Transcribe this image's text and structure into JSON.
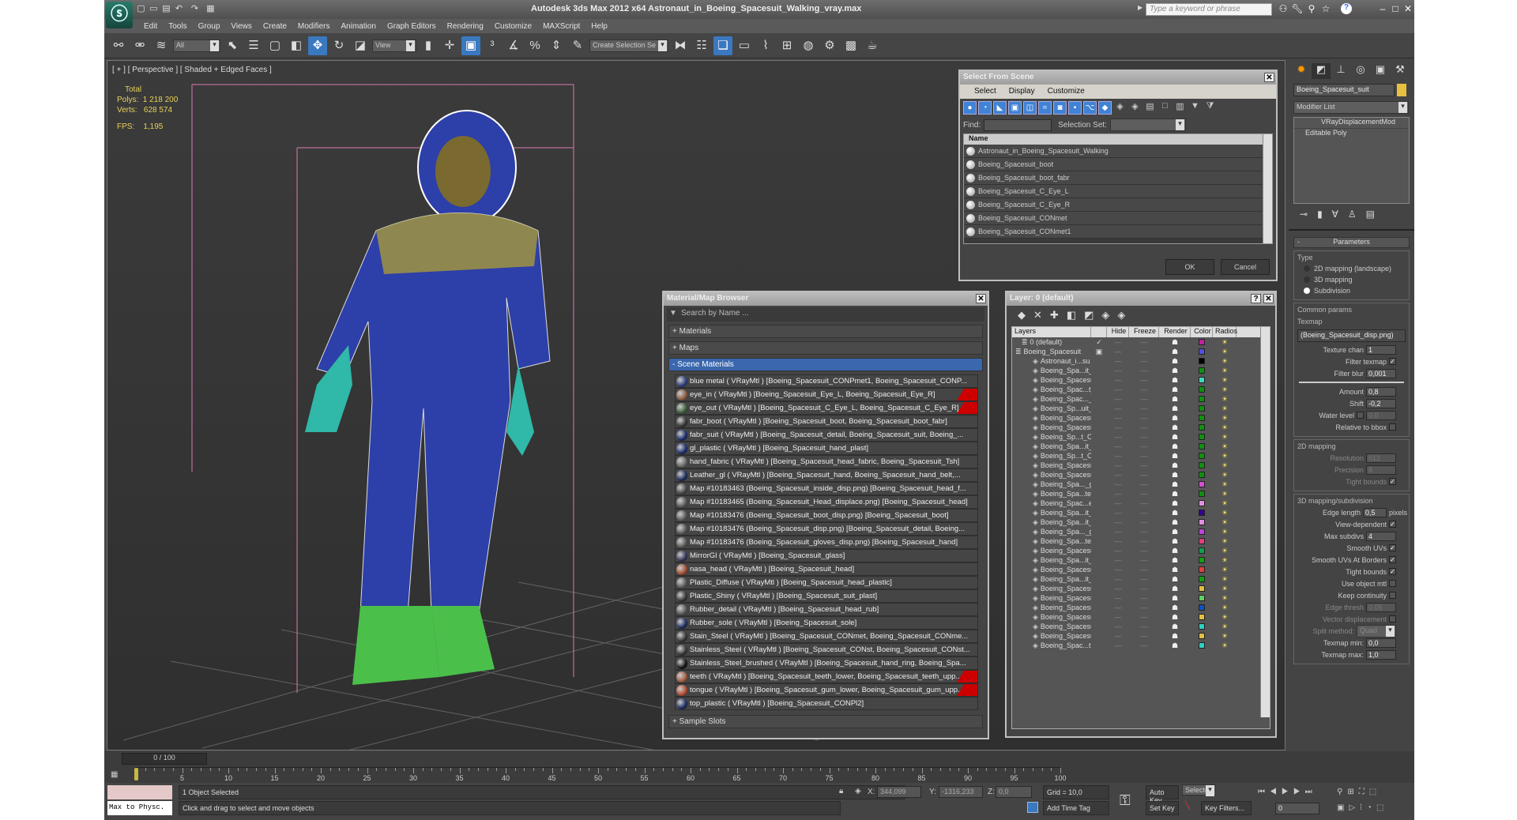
{
  "app": {
    "title": "Autodesk 3ds Max  2012 x64    Astronaut_in_Boeing_Spacesuit_Walking_vray.max",
    "search_placeholder": "Type a keyword or phrase"
  },
  "menu": [
    "Edit",
    "Tools",
    "Group",
    "Views",
    "Create",
    "Modifiers",
    "Animation",
    "Graph Editors",
    "Rendering",
    "Customize",
    "MAXScript",
    "Help"
  ],
  "toolbar": {
    "filter_value": "All",
    "ref_coord_value": "View",
    "selection_set_placeholder": "Create Selection Se"
  },
  "viewport": {
    "label": "[ + ] [ Perspective ] [ Shaded + Edged Faces ]",
    "stats": {
      "total": "Total",
      "polys": "Polys:  1 218 200",
      "verts": "Verts:   628 574",
      "fps": "FPS:    1,195"
    }
  },
  "select_from_scene": {
    "title": "Select From Scene",
    "menu": [
      "Select",
      "Display",
      "Customize"
    ],
    "find_label": "Find:",
    "selection_set_label": "Selection Set:",
    "column": "Name",
    "items": [
      "Astronaut_in_Boeing_Spacesuit_Walking",
      "Boeing_Spacesuit_boot",
      "Boeing_Spacesuit_boot_fabr",
      "Boeing_Spacesuit_C_Eye_L",
      "Boeing_Spacesuit_C_Eye_R",
      "Boeing_Spacesuit_CONmet",
      "Boeing_Spacesuit_CONmet1"
    ],
    "ok": "OK",
    "cancel": "Cancel"
  },
  "material_browser": {
    "title": "Material/Map Browser",
    "search_placeholder": "Search by Name ...",
    "groups": {
      "materials": "+ Materials",
      "maps": "+ Maps",
      "scene": "- Scene Materials",
      "sample": "+ Sample Slots"
    },
    "items": [
      {
        "text": "blue metal  ( VRayMtl ) [Boeing_Spacesuit_CONPmet1, Boeing_Spacesuit_CONP...",
        "color": "#2a3a7a",
        "flag": false
      },
      {
        "text": "eye_in  ( VRayMtl ) [Boeing_Spacesuit_Eye_L, Boeing_Spacesuit_Eye_R]",
        "color": "#8a5a40",
        "flag": true
      },
      {
        "text": "eye_out  ( VRayMtl ) [Boeing_Spacesuit_C_Eye_L, Boeing_Spacesuit_C_Eye_R]",
        "color": "#3a5a3a",
        "flag": true
      },
      {
        "text": "fabr_boot ( VRayMtl ) [Boeing_Spacesuit_boot, Boeing_Spacesuit_boot_fabr]",
        "color": "#333",
        "flag": false
      },
      {
        "text": "fabr_suit ( VRayMtl ) [Boeing_Spacesuit_detail, Boeing_Spacesuit_suit, Boeing_...",
        "color": "#1a2a6a",
        "flag": false
      },
      {
        "text": "gl_plastic  ( VRayMtl ) [Boeing_Spacesuit_hand_plast]",
        "color": "#1a2a6a",
        "flag": false
      },
      {
        "text": "hand_fabric  ( VRayMtl ) [Boeing_Spacesuit_head_fabric, Boeing_Spacesuit_Tsh]",
        "color": "#666",
        "flag": false
      },
      {
        "text": "Leather_gl  ( VRayMtl ) [Boeing_Spacesuit_hand, Boeing_Spacesuit_hand_belt,...",
        "color": "#1a2a5a",
        "flag": false
      },
      {
        "text": "Map #10183463 (Boeing_Spacesuit_inside_disp.png) [Boeing_Spacesuit_head_f...",
        "color": "#454545",
        "flag": false
      },
      {
        "text": "Map #10183465 (Boeing_Spacesuit_Head_displace.png) [Boeing_Spacesuit_head]",
        "color": "#555",
        "flag": false
      },
      {
        "text": "Map #10183476 (Boeing_Spacesuit_boot_disp.png) [Boeing_Spacesuit_boot]",
        "color": "#555",
        "flag": false
      },
      {
        "text": "Map #10183476 (Boeing_Spacesuit_disp.png) [Boeing_Spacesuit_detail, Boeing...",
        "color": "#555",
        "flag": false
      },
      {
        "text": "Map #10183476 (Boeing_Spacesuit_gloves_disp.png) [Boeing_Spacesuit_hand]",
        "color": "#555",
        "flag": false
      },
      {
        "text": "MirrorGl  ( VRayMtl ) [Boeing_Spacesuit_glass]",
        "color": "#335",
        "flag": false
      },
      {
        "text": "nasa_head  ( VRayMtl ) [Boeing_Spacesuit_head]",
        "color": "#a04a30",
        "flag": false
      },
      {
        "text": "Plastic_Diffuse  ( VRayMtl ) [Boeing_Spacesuit_head_plastic]",
        "color": "#555",
        "flag": false
      },
      {
        "text": "Plastic_Shiny  ( VRayMtl ) [Boeing_Spacesuit_suit_plast]",
        "color": "#333",
        "flag": false
      },
      {
        "text": "Rubber_detail  ( VRayMtl ) [Boeing_Spacesuit_head_rub]",
        "color": "#555",
        "flag": false
      },
      {
        "text": "Rubber_sole  ( VRayMtl ) [Boeing_Spacesuit_sole]",
        "color": "#1a2a5a",
        "flag": false
      },
      {
        "text": "Stain_Steel  ( VRayMtl ) [Boeing_Spacesuit_CONmet, Boeing_Spacesuit_CONme...",
        "color": "#333",
        "flag": false
      },
      {
        "text": "Stainless_Steel  ( VRayMtl ) [Boeing_Spacesuit_CONst, Boeing_Spacesuit_CONst...",
        "color": "#333",
        "flag": false
      },
      {
        "text": "Stainless_Steel_brushed  ( VRayMtl ) [Boeing_Spacesuit_hand_ring, Boeing_Spa...",
        "color": "#111",
        "flag": false
      },
      {
        "text": "teeth  ( VRayMtl ) [Boeing_Spacesuit_teeth_lower, Boeing_Spacesuit_teeth_upp...",
        "color": "#a05a40",
        "flag": true
      },
      {
        "text": "tongue  ( VRayMtl ) [Boeing_Spacesuit_gum_lower, Boeing_Spacesuit_gum_upp...",
        "color": "#b04a30",
        "flag": true
      },
      {
        "text": "top_plastic  ( VRayMtl ) [Boeing_Spacesuit_CONPl2]",
        "color": "#1a2a5a",
        "flag": false
      }
    ]
  },
  "layer": {
    "title": "Layer: 0 (default)",
    "columns": [
      "Layers",
      "",
      "Hide",
      "Freeze",
      "Render",
      "Color",
      "Radios"
    ],
    "default_layer": {
      "name": "0 (default)",
      "color": "#c020a0"
    },
    "parent_layer": {
      "name": "Boeing_Spacesuit",
      "color": "#5050e0"
    },
    "objects": [
      {
        "name": "Astronaut_i...su",
        "color": "#000000"
      },
      {
        "name": "Boeing_Spa...it_",
        "color": "#109010"
      },
      {
        "name": "Boeing_Spacesui",
        "color": "#40d8c0"
      },
      {
        "name": "Boeing_Spac...t_",
        "color": "#109010"
      },
      {
        "name": "Boeing_Spac..._",
        "color": "#109010"
      },
      {
        "name": "Boeing_Sp...uit_",
        "color": "#109010"
      },
      {
        "name": "Boeing_Spacesui",
        "color": "#109010"
      },
      {
        "name": "Boeing_Spacesui",
        "color": "#109010"
      },
      {
        "name": "Boeing_Sp...t_C",
        "color": "#109010"
      },
      {
        "name": "Boeing_Spa...it_",
        "color": "#109010"
      },
      {
        "name": "Boeing_Sp...t_C",
        "color": "#109010"
      },
      {
        "name": "Boeing_Spacesui",
        "color": "#109010"
      },
      {
        "name": "Boeing_Spacesui",
        "color": "#109010"
      },
      {
        "name": "Boeing_Spa..._g",
        "color": "#d050d0"
      },
      {
        "name": "Boeing_Spa...te",
        "color": "#109010"
      },
      {
        "name": "Boeing_Spac...e",
        "color": "#e090e0"
      },
      {
        "name": "Boeing_Spa...it_",
        "color": "#300090"
      },
      {
        "name": "Boeing_Spa...it_",
        "color": "#e090e0"
      },
      {
        "name": "Boeing_Spa..._g",
        "color": "#c040e0"
      },
      {
        "name": "Boeing_Spa...te",
        "color": "#e04080"
      },
      {
        "name": "Boeing_Spacesui",
        "color": "#10a050"
      },
      {
        "name": "Boeing_Spa...it_",
        "color": "#10a010"
      },
      {
        "name": "Boeing_Spacesui",
        "color": "#e04040"
      },
      {
        "name": "Boeing_Spa...it_",
        "color": "#10a010"
      },
      {
        "name": "Boeing_Spacesui",
        "color": "#e0c040"
      },
      {
        "name": "Boeing_Spacesui",
        "color": "#60d060"
      },
      {
        "name": "Boeing_Spacesui",
        "color": "#1050c0"
      },
      {
        "name": "Boeing_Spacesui",
        "color": "#e0c040"
      },
      {
        "name": "Boeing_Spacesui",
        "color": "#30d0c0"
      },
      {
        "name": "Boeing_Spacesui",
        "color": "#e0c040"
      },
      {
        "name": "Boeing_Spac...t",
        "color": "#30d0c0"
      }
    ]
  },
  "command_panel": {
    "object_name": "Boeing_Spacesuit_suit",
    "object_color": "#e8c040",
    "modifier_list": "Modifier List",
    "stack": [
      "VRayDisplacementMod",
      "Editable Poly"
    ],
    "rollout": "Parameters",
    "type_label": "Type",
    "type_options": [
      "2D mapping (landscape)",
      "3D mapping",
      "Subdivision"
    ],
    "type_selected": 2,
    "common_label": "Common params",
    "texmap_label": "Texmap",
    "texmap_value": "(Boeing_Spacesuit_disp.png)",
    "texture_chan_label": "Texture chan",
    "texture_chan": "1",
    "filter_texmap_label": "Filter texmap",
    "filter_blur_label": "Filter blur",
    "filter_blur": "0,001",
    "amount_label": "Amount",
    "amount": "0,8",
    "shift_label": "Shift",
    "shift": "-0,2",
    "water_label": "Water level",
    "water": "0,0",
    "relative_label": "Relative to bbox",
    "map2d_label": "2D mapping",
    "resolution_label": "Resolution",
    "resolution": "512",
    "precision_label": "Precision",
    "precision": "8",
    "tight_label": "Tight bounds",
    "map3d_label": "3D mapping/subdivision",
    "edge_length_label": "Edge length",
    "edge_length": "0,5",
    "pixels_label": "pixels",
    "view_dep_label": "View-dependent",
    "max_subdivs_label": "Max subdivs",
    "max_subdivs": "4",
    "smooth_uvs_label": "Smooth UVs",
    "smooth_borders_label": "Smooth UVs At Borders",
    "tight2_label": "Tight bounds",
    "use_obj_label": "Use object mtl",
    "keep_cont_label": "Keep continuity",
    "edge_thresh_label": "Edge thresh",
    "edge_thresh": "0,05",
    "vector_label": "Vector displacement",
    "split_label": "Split method:",
    "split_value": "Quad",
    "texmap_min_label": "Texmap min:",
    "texmap_min": "0,0",
    "texmap_max_label": "Texmap max:",
    "texmap_max": "1,0"
  },
  "timeline": {
    "slider": "0 / 100",
    "ticks": [
      "0",
      "5",
      "10",
      "15",
      "20",
      "25",
      "30",
      "35",
      "40",
      "45",
      "50",
      "55",
      "60",
      "65",
      "70",
      "75",
      "80",
      "85",
      "90",
      "95",
      "100"
    ]
  },
  "status": {
    "maxscript": "Max to Physc.",
    "selected": "1 Object Selected",
    "prompt": "Click and drag to select and move objects",
    "x_label": "X:",
    "x": "344,099",
    "y_label": "Y:",
    "y": "-1316,233",
    "z_label": "Z:",
    "z": "0,0",
    "grid": "Grid = 10,0",
    "add_time_tag": "Add Time Tag",
    "auto_key": "Auto Key",
    "set_key": "Set Key",
    "key_mode": "Selected",
    "key_filters": "Key Filters...",
    "frame": "0"
  }
}
